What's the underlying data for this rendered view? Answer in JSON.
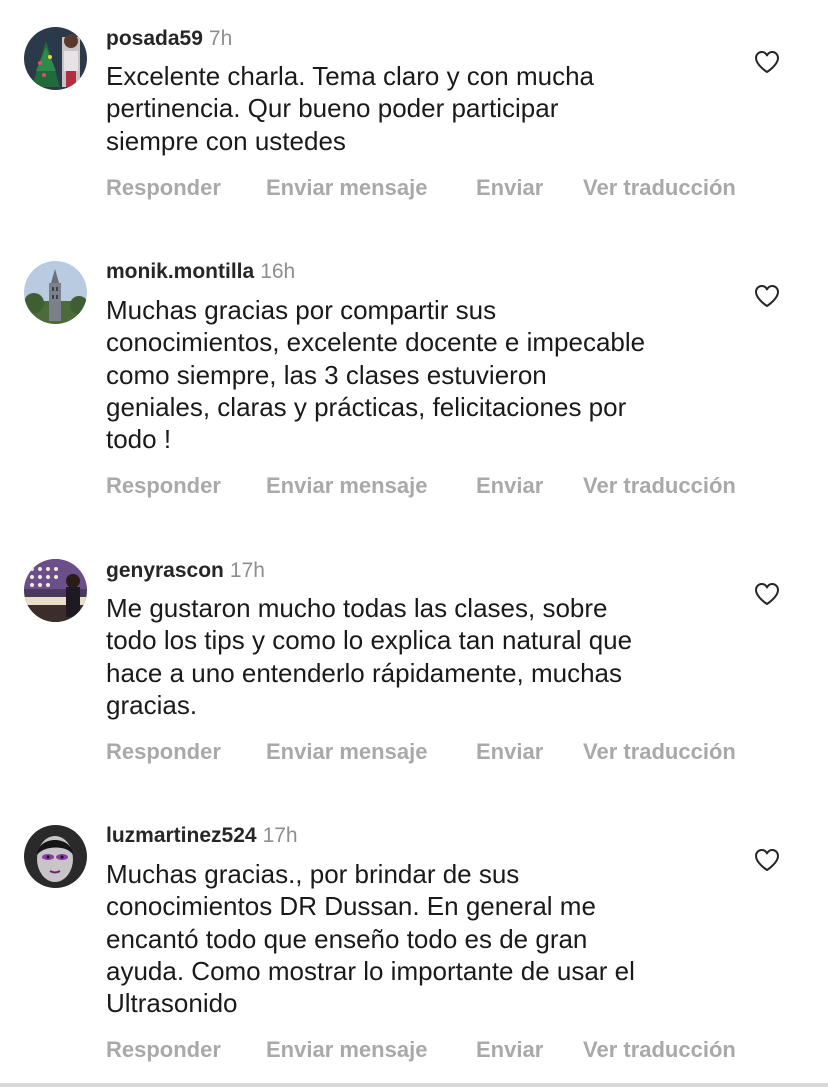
{
  "actions": {
    "reply": "Responder",
    "send_message": "Enviar mensaje",
    "send": "Enviar",
    "see_translation": "Ver traducción"
  },
  "comments": [
    {
      "username": "posada59",
      "time": "7h",
      "lines": [
        "Excelente charla. Tema claro y con mucha",
        "pertinencia. Qur bueno poder participar",
        "siempre con ustedes"
      ],
      "avatar": "photo"
    },
    {
      "username": "monik.montilla",
      "time": "16h",
      "lines": [
        "Muchas gracias por compartir sus",
        "conocimientos, excelente docente e impecable",
        "como siempre, las 3 clases estuvieron",
        "geniales, claras y prácticas, felicitaciones por",
        "todo !"
      ],
      "avatar": "photo"
    },
    {
      "username": "genyrascon",
      "time": "17h",
      "lines": [
        "Me gustaron mucho todas las clases,  sobre",
        "todo los tips y como lo explica tan natural que",
        "hace a uno entenderlo rápidamente,  muchas",
        "gracias."
      ],
      "avatar": "photo"
    },
    {
      "username": "luzmartinez524",
      "time": "17h",
      "lines": [
        "Muchas gracias., por brindar de sus",
        "conocimientos DR Dussan. En general me",
        "encantó todo que enseño todo es de gran",
        "ayuda. Como mostrar lo importante de usar el",
        "Ultrasonido"
      ],
      "avatar": "photo"
    }
  ],
  "icons": {
    "like": "heart-outline-icon"
  }
}
